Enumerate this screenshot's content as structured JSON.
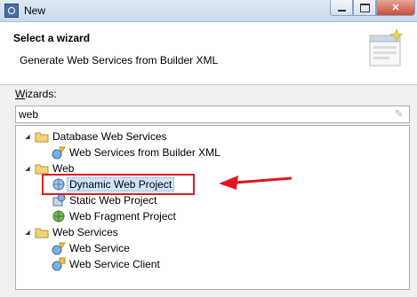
{
  "window": {
    "title": "New"
  },
  "header": {
    "title": "Select a wizard",
    "description": "Generate Web Services from Builder XML"
  },
  "wizards": {
    "label_accel": "W",
    "label_rest": "izards:"
  },
  "filter": {
    "value": "web"
  },
  "tree": [
    {
      "label": "Database Web Services",
      "icon": "folder-icon",
      "children": [
        {
          "label": "Web Services from Builder XML",
          "icon": "web-service-icon"
        }
      ]
    },
    {
      "label": "Web",
      "icon": "folder-icon",
      "children": [
        {
          "label": "Dynamic Web Project",
          "icon": "dynamic-web-project-icon"
        },
        {
          "label": "Static Web Project",
          "icon": "static-web-project-icon"
        },
        {
          "label": "Web Fragment Project",
          "icon": "web-fragment-project-icon"
        }
      ]
    },
    {
      "label": "Web Services",
      "icon": "folder-icon",
      "children": [
        {
          "label": "Web Service",
          "icon": "web-service-icon"
        },
        {
          "label": "Web Service Client",
          "icon": "web-service-client-icon"
        }
      ]
    }
  ],
  "colors": {
    "annotation": "#e3161d",
    "folder": "#e8c15a",
    "selection": "#cfe3fb"
  }
}
